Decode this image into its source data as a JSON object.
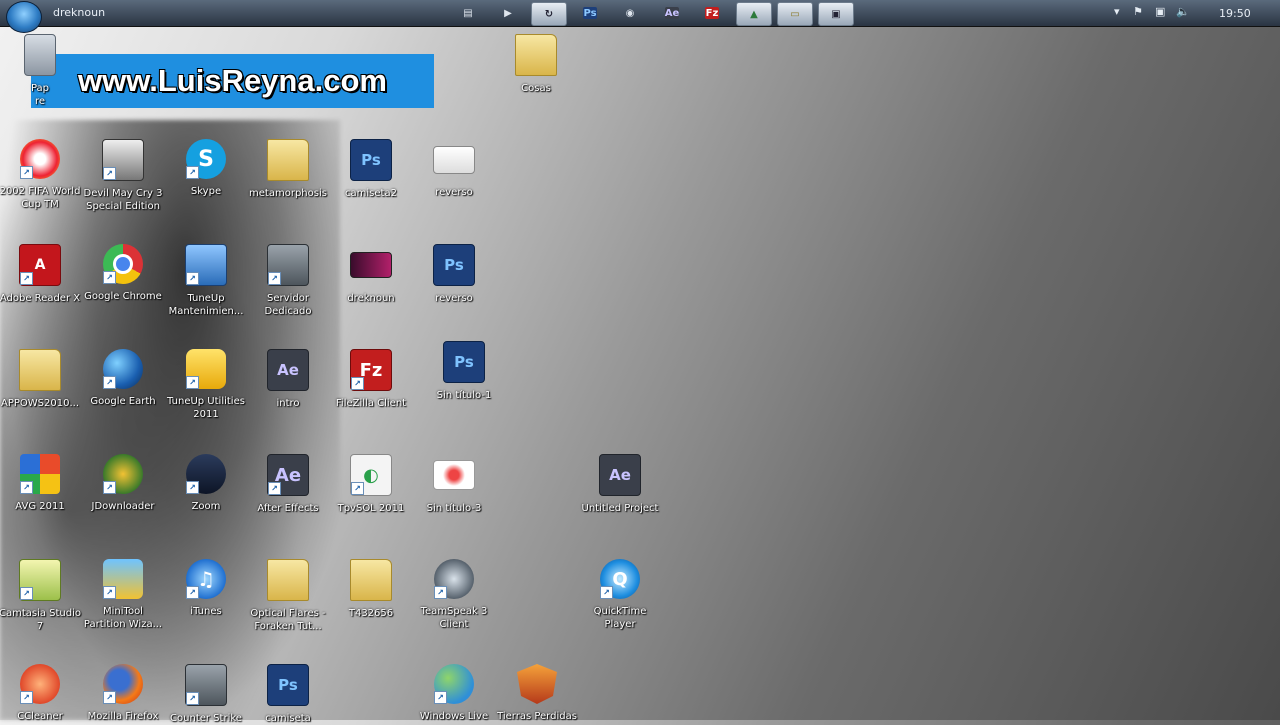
{
  "taskbar": {
    "window_title": "dreknoun",
    "clock": "19:50",
    "buttons": [
      {
        "name": "explorer",
        "glyph": "▤"
      },
      {
        "name": "media-player",
        "glyph": "▶"
      },
      {
        "name": "refresh",
        "glyph": "↻"
      },
      {
        "name": "photoshop",
        "glyph": "Ps"
      },
      {
        "name": "chrome",
        "glyph": "◉"
      },
      {
        "name": "after-effects",
        "glyph": "Ae"
      },
      {
        "name": "filezilla",
        "glyph": "Fz"
      },
      {
        "name": "landscape",
        "glyph": "▲"
      },
      {
        "name": "notes",
        "glyph": "▭"
      },
      {
        "name": "settings",
        "glyph": "▣"
      }
    ],
    "tray": {
      "arrow": "▾",
      "flag": "⚑",
      "network": "▣",
      "volume": "🔈"
    }
  },
  "watermark": {
    "text": "www.LuisReyna.com"
  },
  "desktop_icons": [
    {
      "label": "Pap\nre",
      "icon": "recycle-bin"
    },
    {
      "label": "Cosas",
      "icon": "folder"
    },
    {
      "label": "2002 FIFA World\nCup TM",
      "icon": "fifa"
    },
    {
      "label": "Devil May Cry 3\nSpecial Edition",
      "icon": "dmc3"
    },
    {
      "label": "Skype",
      "icon": "skype"
    },
    {
      "label": "metamorphosis",
      "icon": "folder"
    },
    {
      "label": "camiseta2",
      "icon": "psd"
    },
    {
      "label": "reverso",
      "icon": "image"
    },
    {
      "label": "Adobe Reader X",
      "icon": "adobe-reader"
    },
    {
      "label": "Google Chrome",
      "icon": "chrome"
    },
    {
      "label": "TuneUp\nMantenimien...",
      "icon": "tuneup"
    },
    {
      "label": "Servidor\nDedicado",
      "icon": "counter-strike"
    },
    {
      "label": "dreknoun",
      "icon": "image"
    },
    {
      "label": "reverso",
      "icon": "psd"
    },
    {
      "label": "APPOWS2010...",
      "icon": "folder"
    },
    {
      "label": "Google Earth",
      "icon": "google-earth"
    },
    {
      "label": "TuneUp Utilities\n2011",
      "icon": "tuneup-utilities"
    },
    {
      "label": "intro",
      "icon": "aep"
    },
    {
      "label": "FileZilla Client",
      "icon": "filezilla"
    },
    {
      "label": "Sin título-1",
      "icon": "psd"
    },
    {
      "label": "AVG 2011",
      "icon": "avg"
    },
    {
      "label": "JDownloader",
      "icon": "jdownloader"
    },
    {
      "label": "Zoom",
      "icon": "zoom"
    },
    {
      "label": "After Effects",
      "icon": "after-effects"
    },
    {
      "label": "TpvSOL 2011",
      "icon": "tpvsol"
    },
    {
      "label": "Sin título-3",
      "icon": "image"
    },
    {
      "label": "Untitled Project",
      "icon": "aep"
    },
    {
      "label": "Camtasia Studio\n7",
      "icon": "camtasia"
    },
    {
      "label": "MiniTool\nPartition Wiza...",
      "icon": "minitool"
    },
    {
      "label": "iTunes",
      "icon": "itunes"
    },
    {
      "label": "Optical Flares -\nForaken Tut...",
      "icon": "folder"
    },
    {
      "label": "T432656",
      "icon": "folder"
    },
    {
      "label": "TeamSpeak 3\nClient",
      "icon": "teamspeak"
    },
    {
      "label": "QuickTime\nPlayer",
      "icon": "quicktime"
    },
    {
      "label": "CCleaner",
      "icon": "ccleaner"
    },
    {
      "label": "Mozilla Firefox",
      "icon": "firefox"
    },
    {
      "label": "Counter Strike",
      "icon": "counter-strike"
    },
    {
      "label": "camiseta",
      "icon": "psd"
    },
    {
      "label": "Windows Live",
      "icon": "windows-live"
    },
    {
      "label": "Tierras Perdidas",
      "icon": "tierras-perdidas"
    }
  ]
}
